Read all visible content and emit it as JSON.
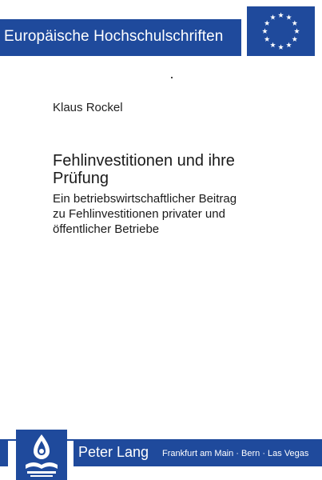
{
  "series": {
    "label": "Europäische Hochschulschriften"
  },
  "book": {
    "author": "Klaus Rockel",
    "title_line1": "Fehlinvestitionen und ihre",
    "title_line2": "Prüfung",
    "subtitle_lines": [
      "Ein betriebswirtschaftlicher Beitrag",
      "zu Fehlinvestitionen privater und",
      "öffentlicher Betriebe"
    ]
  },
  "publisher": {
    "name": "Peter Lang",
    "cities": "Frankfurt am Main · Bern · Las Vegas"
  },
  "colors": {
    "brand_blue": "#1f4a9c",
    "text": "#1a1a1a",
    "paper": "#ffffff"
  },
  "icons": {
    "eu_emblem": "eu-stars-icon",
    "publisher_logo": "peter-lang-logo-icon"
  }
}
